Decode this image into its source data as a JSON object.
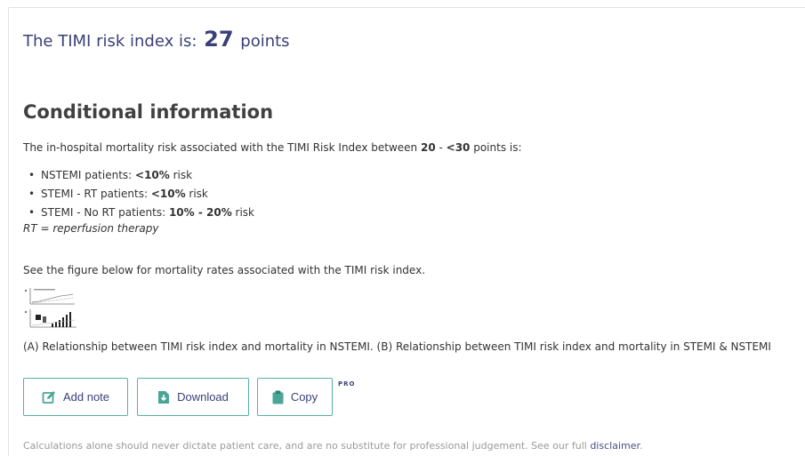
{
  "result": {
    "prefix": "The TIMI risk index is:",
    "score": "27",
    "unit": "points"
  },
  "conditional": {
    "title": "Conditional information",
    "intro_before": "The in-hospital mortality risk associated with the TIMI Risk Index between ",
    "range_low": "20",
    "range_sep": " - ",
    "range_high": "<30",
    "intro_after": " points is:",
    "items": [
      {
        "label": "NSTEMI patients: ",
        "value": "<10%",
        "suffix": " risk"
      },
      {
        "label": "STEMI - RT patients: ",
        "value": "<10%",
        "suffix": " risk"
      },
      {
        "label": "STEMI - No RT patients: ",
        "value": "10% - 20%",
        "suffix": " risk"
      }
    ],
    "rt_note": "RT = reperfusion therapy",
    "see_figure": "See the figure below for mortality rates associated with the TIMI risk index.",
    "caption": "(A) Relationship between TIMI risk index and mortality in NSTEMI. (B) Relationship between TIMI risk index and mortality in STEMI & NSTEMI"
  },
  "actions": {
    "add_note": "Add note",
    "download": "Download",
    "copy": "Copy",
    "pro": "PRO"
  },
  "footer": {
    "disclaimer_text": "Calculations alone should never dictate patient care, and are no substitute for professional judgement. See our full ",
    "disclaimer_link": "disclaimer",
    "disclaimer_end": "."
  },
  "colors": {
    "accent_text": "#3b3f78",
    "button_border": "#57b1a4",
    "icon": "#4aa596"
  },
  "icons": {
    "add_note": "edit-note-icon",
    "download": "download-icon",
    "copy": "clipboard-icon"
  }
}
